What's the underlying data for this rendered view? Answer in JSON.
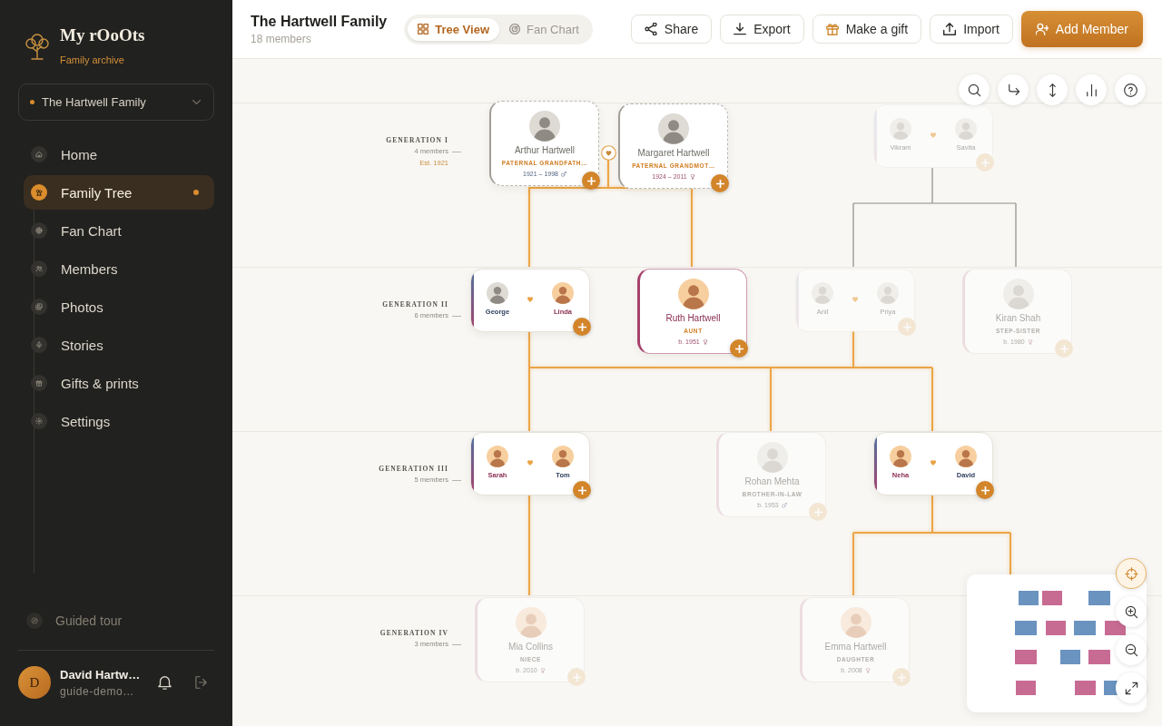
{
  "sidebar": {
    "brand": {
      "name": "My rOoOts",
      "tagline": "Family archive"
    },
    "family_selector": {
      "value": "The Hartwell Family"
    },
    "nav": [
      {
        "label": "Home",
        "selected": false
      },
      {
        "label": "Family Tree",
        "selected": true
      },
      {
        "label": "Fan Chart",
        "selected": false
      },
      {
        "label": "Members",
        "selected": false
      },
      {
        "label": "Photos",
        "selected": false
      },
      {
        "label": "Stories",
        "selected": false
      },
      {
        "label": "Gifts & prints",
        "selected": false
      },
      {
        "label": "Settings",
        "selected": false
      }
    ],
    "guided_tour": {
      "label": "Guided tour"
    },
    "user": {
      "initial": "D",
      "name": "David Hartw…",
      "email": "guide-demo…"
    }
  },
  "header": {
    "title": "The Hartwell Family",
    "subtitle": "18 members",
    "view_tabs": [
      {
        "label": "Tree View",
        "selected": true
      },
      {
        "label": "Fan Chart",
        "selected": false
      }
    ],
    "actions": [
      {
        "label": "Share",
        "primary": false
      },
      {
        "label": "Export",
        "primary": false
      },
      {
        "label": "Make a gift",
        "primary": false
      },
      {
        "label": "Import",
        "primary": false
      },
      {
        "label": "Add Member",
        "primary": true
      }
    ]
  },
  "tree": {
    "generations": [
      {
        "label": "GENERATION I",
        "count": "4 members",
        "note": "Est. 1921",
        "cards": [
          {
            "kind": "single",
            "dimmed": false,
            "person": {
              "name": "Arthur Hartwell",
              "role": "PATERNAL GRANDFATH…",
              "dates": "1921 – 1998",
              "kind": "male",
              "deceased": true,
              "sepia": true
            }
          },
          {
            "kind": "single",
            "dimmed": false,
            "person": {
              "name": "Margaret Hartwell",
              "role": "PATERNAL GRANDMOT…",
              "dates": "1924 – 2011",
              "kind": "female",
              "deceased": true,
              "sepia": true
            }
          },
          {
            "kind": "couple",
            "dimmed": true,
            "partners": [
              {
                "name": "Vikram",
                "kind": "male",
                "sepia": true
              },
              {
                "name": "Savita",
                "kind": "female",
                "sepia": true
              }
            ]
          }
        ]
      },
      {
        "label": "GENERATION II",
        "count": "6 members",
        "cards": [
          {
            "kind": "couple",
            "dimmed": false,
            "partners": [
              {
                "name": "George",
                "kind": "male",
                "sepia": true
              },
              {
                "name": "Linda",
                "kind": "female",
                "sepia": false
              }
            ]
          },
          {
            "kind": "single",
            "dimmed": false,
            "person": {
              "name": "Ruth Hartwell",
              "role": "AUNT",
              "dates": "b. 1951",
              "kind": "female",
              "deceased": false,
              "sepia": false
            }
          },
          {
            "kind": "couple",
            "dimmed": true,
            "partners": [
              {
                "name": "Anil",
                "kind": "male",
                "sepia": true
              },
              {
                "name": "Priya",
                "kind": "female",
                "sepia": true
              }
            ]
          },
          {
            "kind": "single",
            "dimmed": true,
            "person": {
              "name": "Kiran Shah",
              "role": "STEP-SISTER",
              "dates": "b. 1980",
              "kind": "female",
              "deceased": false,
              "sepia": true
            }
          }
        ]
      },
      {
        "label": "GENERATION III",
        "count": "5 members",
        "cards": [
          {
            "kind": "couple",
            "dimmed": false,
            "partners": [
              {
                "name": "Sarah",
                "kind": "female",
                "sepia": false
              },
              {
                "name": "Tom",
                "kind": "male",
                "sepia": false
              }
            ]
          },
          {
            "kind": "single",
            "dimmed": true,
            "person": {
              "name": "Rohan Mehta",
              "role": "BROTHER-IN-LAW",
              "dates": "b. 1953",
              "kind": "male",
              "deceased": false,
              "sepia": true
            }
          },
          {
            "kind": "couple",
            "dimmed": false,
            "partners": [
              {
                "name": "Neha",
                "kind": "female",
                "sepia": false
              },
              {
                "name": "David",
                "kind": "male",
                "sepia": false
              }
            ]
          }
        ]
      },
      {
        "label": "GENERATION IV",
        "count": "3 members",
        "cards": [
          {
            "kind": "single",
            "dimmed": true,
            "person": {
              "name": "Mia Collins",
              "role": "NIECE",
              "dates": "b. 2010",
              "kind": "female",
              "deceased": false,
              "sepia": false
            }
          },
          {
            "kind": "single",
            "dimmed": true,
            "person": {
              "name": "Emma Hartwell",
              "role": "DAUGHTER",
              "dates": "b. 2008",
              "kind": "female",
              "deceased": false,
              "sepia": false
            }
          }
        ]
      }
    ]
  }
}
